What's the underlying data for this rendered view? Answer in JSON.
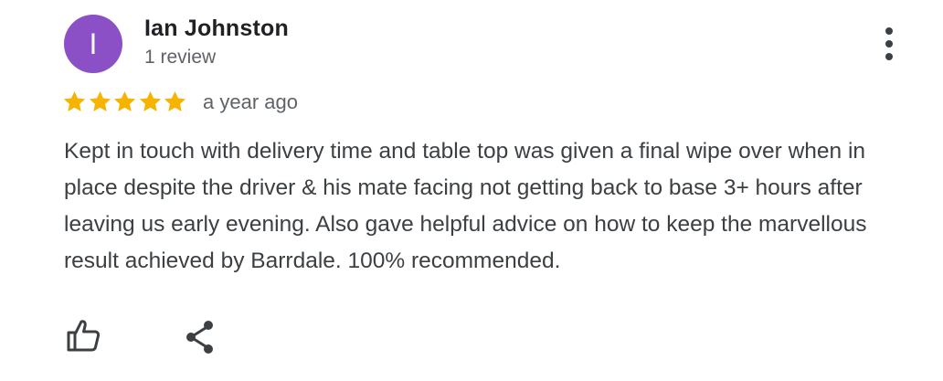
{
  "reviewer": {
    "initial": "I",
    "name": "Ian Johnston",
    "review_count": "1 review",
    "avatar_color": "#8b4fc6"
  },
  "rating": {
    "stars": 5,
    "max": 5,
    "star_color": "#f6b400"
  },
  "date": "a year ago",
  "review_text": "Kept in touch with delivery time and table top was given a final wipe over when in place despite the driver & his mate facing not getting back to base 3+ hours after leaving us early evening. Also gave helpful advice on how to keep the marvellous result achieved by Barrdale. 100% recommended.",
  "actions": [
    "like-icon",
    "share-icon",
    "more-options-icon"
  ]
}
